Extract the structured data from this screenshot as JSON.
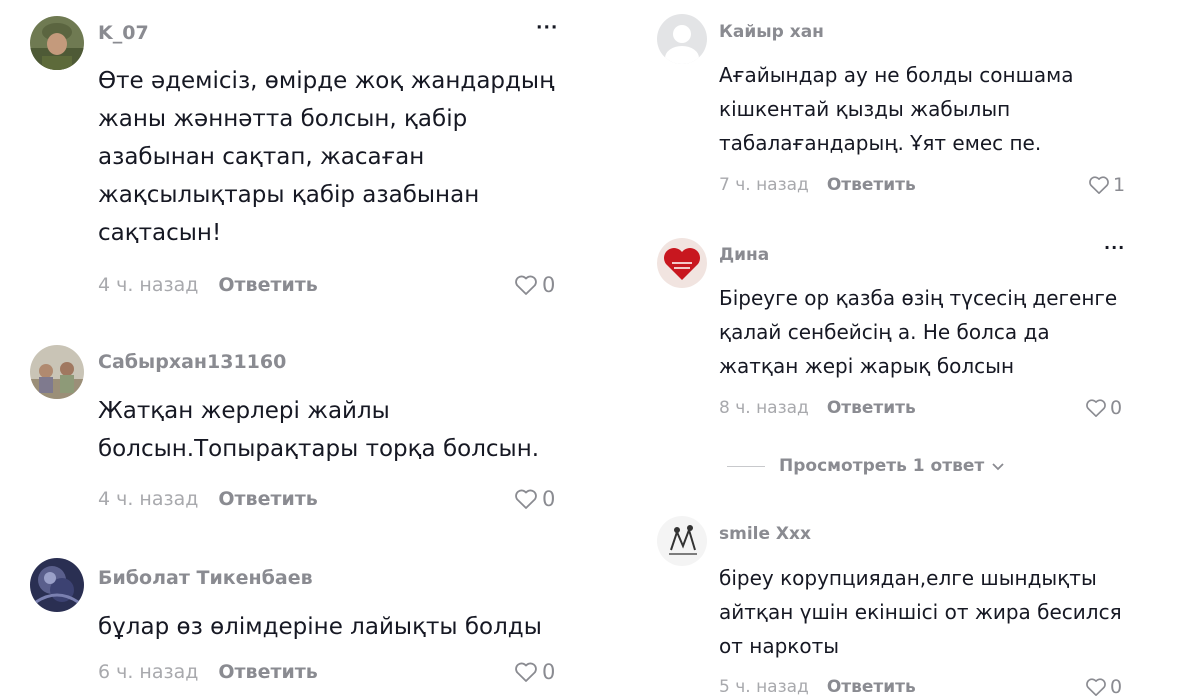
{
  "reply_label": "Ответить",
  "more_label": "···",
  "left_comments": [
    {
      "username": "K_07",
      "lines": [
        "Өте әдемісіз, өмірде жоқ жандардың",
        "жаны жәннәтта болсын, қабір",
        "азабынан сақтап, жасаған",
        "жақсылықтары қабір азабынан",
        "сақтасын!"
      ],
      "time": "4 ч. назад",
      "likes": "0",
      "avatar": "military-photo-avatar"
    },
    {
      "username": "Сабырхан131160",
      "lines": [
        "Жатқан жерлері жайлы",
        "болсын.Топырақтары торқа болсын."
      ],
      "time": "4 ч. назад",
      "likes": "0",
      "avatar": "group-photo-avatar"
    },
    {
      "username": "Биболат Тикенбаев",
      "lines": [
        "бұлар өз өлімдеріне лайықты болды"
      ],
      "time": "6 ч. назад",
      "likes": "0",
      "avatar": "dark-abstract-avatar"
    }
  ],
  "right_comments": [
    {
      "username": "Кайыр хан",
      "lines": [
        "Ағайындар ау не болды соншама",
        "кішкентай қызды жабылып",
        "табалағандарың. Ұят емес пе."
      ],
      "time": "7 ч. назад",
      "likes": "1",
      "avatar": "default-user-avatar"
    },
    {
      "username": "Дина",
      "lines": [
        "Біреуге ор қазба өзің түсесің дегенге",
        "қалай сенбейсің а. Не болса да",
        "жатқан жері жарық болсын"
      ],
      "time": "8 ч. назад",
      "likes": "0",
      "avatar": "red-heart-avatar"
    },
    {
      "username": "smile Xxx",
      "lines": [
        "біреу корупциядан,елге шындықты",
        "айтқан үшін екіншісі от жира бесился",
        "от наркоты"
      ],
      "time": "5 ч. назад",
      "likes": "0",
      "avatar": "sketch-avatar"
    }
  ],
  "view_replies_label": "Просмотреть 1 ответ",
  "colors": {
    "username": "#8a8b91",
    "text": "#161823",
    "time": "#a8a9ad"
  }
}
